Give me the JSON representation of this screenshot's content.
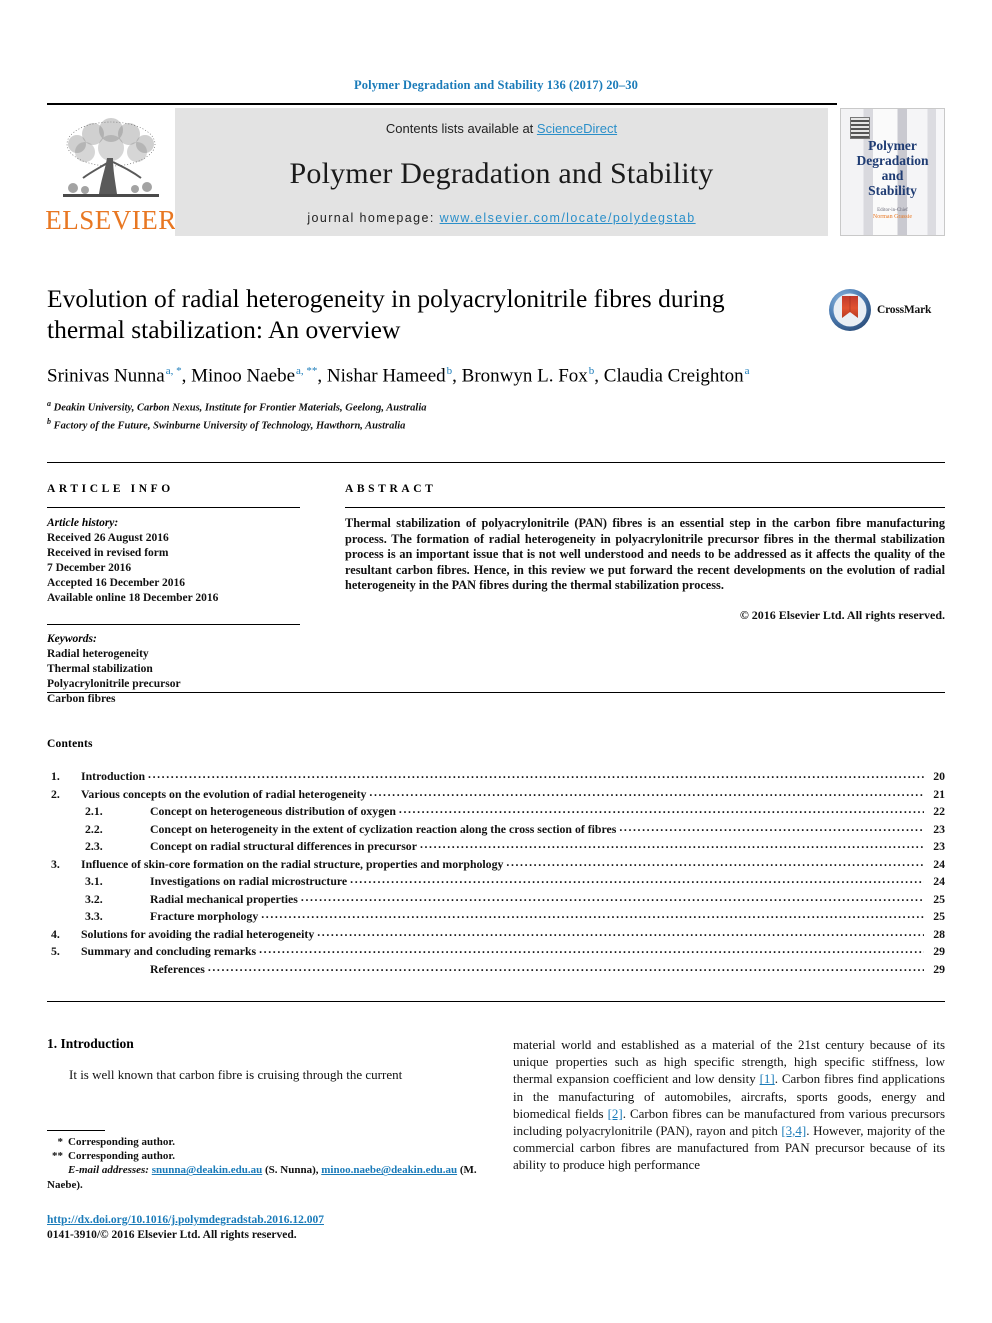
{
  "running_head": "Polymer Degradation and Stability 136 (2017) 20–30",
  "banner": {
    "contents_prefix": "Contents lists available at ",
    "sciencedirect": "ScienceDirect",
    "journal_name": "Polymer Degradation and Stability",
    "homepage_prefix": "journal homepage: ",
    "homepage_url": "www.elsevier.com/locate/polydegstab",
    "publisher": "ELSEVIER",
    "cover_title": "Polymer\nDegradation\nand\nStability",
    "cover_foot_top": "Editor-in-Chief",
    "cover_foot_bottom": "Norman Grassie"
  },
  "article": {
    "title": "Evolution of radial heterogeneity in polyacrylonitrile fibres during thermal stabilization: An overview",
    "authors": [
      {
        "name": "Srinivas Nunna",
        "marks": "a, *"
      },
      {
        "name": "Minoo Naebe",
        "marks": "a, **"
      },
      {
        "name": "Nishar Hameed",
        "marks": "b"
      },
      {
        "name": "Bronwyn L. Fox",
        "marks": "b"
      },
      {
        "name": "Claudia Creighton",
        "marks": "a"
      }
    ],
    "affiliations": [
      {
        "mark": "a",
        "text": "Deakin University, Carbon Nexus, Institute for Frontier Materials, Geelong, Australia"
      },
      {
        "mark": "b",
        "text": "Factory of the Future, Swinburne University of Technology, Hawthorn, Australia"
      }
    ],
    "crossmark_label": "CrossMark"
  },
  "info": {
    "heading": "ARTICLE INFO",
    "history_label": "Article history:",
    "history": [
      "Received 26 August 2016",
      "Received in revised form",
      "7 December 2016",
      "Accepted 16 December 2016",
      "Available online 18 December 2016"
    ],
    "keywords_label": "Keywords:",
    "keywords": [
      "Radial heterogeneity",
      "Thermal stabilization",
      "Polyacrylonitrile precursor",
      "Carbon fibres"
    ]
  },
  "abstract": {
    "heading": "ABSTRACT",
    "text": "Thermal stabilization of polyacrylonitrile (PAN) fibres is an essential step in the carbon fibre manufacturing process. The formation of radial heterogeneity in polyacrylonitrile precursor fibres in the thermal stabilization process is an important issue that is not well understood and needs to be addressed as it affects the quality of the resultant carbon fibres. Hence, in this review we put forward the recent developments on the evolution of radial heterogeneity in the PAN fibres during the thermal stabilization process.",
    "copyright": "© 2016 Elsevier Ltd. All rights reserved."
  },
  "contents": {
    "title": "Contents",
    "entries": [
      {
        "num": "1.",
        "level": 1,
        "label": "Introduction",
        "page": "20"
      },
      {
        "num": "2.",
        "level": 1,
        "label": "Various concepts on the evolution of radial heterogeneity",
        "page": "21"
      },
      {
        "num": "2.1.",
        "level": 2,
        "label": "Concept on heterogeneous distribution of oxygen",
        "page": "22"
      },
      {
        "num": "2.2.",
        "level": 2,
        "label": "Concept on heterogeneity in the extent of cyclization reaction along the cross section of fibres",
        "page": "23"
      },
      {
        "num": "2.3.",
        "level": 2,
        "label": "Concept on radial structural differences in precursor",
        "page": "23"
      },
      {
        "num": "3.",
        "level": 1,
        "label": "Influence of skin-core formation on the radial structure, properties and morphology",
        "page": "24"
      },
      {
        "num": "3.1.",
        "level": 2,
        "label": "Investigations on radial microstructure",
        "page": "24"
      },
      {
        "num": "3.2.",
        "level": 2,
        "label": "Radial mechanical properties",
        "page": "25"
      },
      {
        "num": "3.3.",
        "level": 2,
        "label": "Fracture morphology",
        "page": "25"
      },
      {
        "num": "4.",
        "level": 1,
        "label": "Solutions for avoiding the radial heterogeneity",
        "page": "28"
      },
      {
        "num": "5.",
        "level": 1,
        "label": "Summary and concluding remarks",
        "page": "29"
      },
      {
        "num": "",
        "level": 0,
        "label": "References",
        "page": "29"
      }
    ]
  },
  "body": {
    "section_number_title": "1. Introduction",
    "left_paragraph": "It is well known that carbon fibre is cruising through the current",
    "right_paragraph_parts": [
      {
        "t": "material world and established as a material of the 21st century because of its unique properties such as high specific strength, high specific stiffness, low thermal expansion coefficient and low density "
      },
      {
        "t": "[1]",
        "ref": true
      },
      {
        "t": ". Carbon fibres find applications in the manufacturing of automobiles, aircrafts, sports goods, energy and biomedical fields "
      },
      {
        "t": "[2]",
        "ref": true
      },
      {
        "t": ". Carbon fibres can be manufactured from various precursors including polyacrylonitrile (PAN), rayon and pitch "
      },
      {
        "t": "[3,4]",
        "ref": true
      },
      {
        "t": ". However, majority of the commercial carbon fibres are manufactured from PAN precursor because of its ability to produce high performance"
      }
    ]
  },
  "footnotes": {
    "corresponding_1": "Corresponding author.",
    "corresponding_2": "Corresponding author.",
    "email_label": "E-mail addresses:",
    "email_1": "snunna@deakin.edu.au",
    "email_1_name": " (S. Nunna), ",
    "email_2": "minoo.naebe@deakin.edu.au",
    "email_2_name": " (M. Naebe)."
  },
  "doi": {
    "url": "http://dx.doi.org/10.1016/j.polymdegradstab.2016.12.007",
    "issn": "0141-3910/© 2016 Elsevier Ltd. All rights reserved."
  },
  "colors": {
    "link": "#1a7bb9",
    "elsevier_orange": "#e87722",
    "banner_gray": "#e3e3e3"
  }
}
